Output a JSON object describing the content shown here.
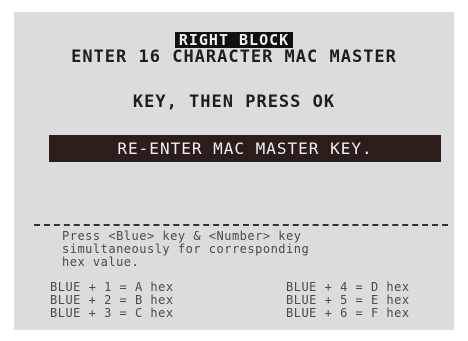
{
  "screen": {
    "title": "RIGHT BLOCK",
    "prompt_lines": [
      "ENTER 16 CHARACTER MAC MASTER",
      "KEY, THEN PRESS OK"
    ],
    "status_message": "RE-ENTER MAC MASTER KEY.",
    "instructions": [
      "Press <Blue> key & <Number> key",
      "simultaneously for corresponding",
      "hex value."
    ],
    "hex_map_left": [
      "BLUE + 1 = A hex",
      "BLUE + 2 = B hex",
      "BLUE + 3 = C hex"
    ],
    "hex_map_right": [
      "BLUE + 4 = D hex",
      "BLUE + 5 = E hex",
      "BLUE + 6 = F hex"
    ]
  },
  "colors": {
    "screen_bg": "#dcdcdc",
    "text": "#1e1e1e",
    "inverse_bg": "#2a1d1a",
    "inverse_text": "#f0f0f0"
  }
}
